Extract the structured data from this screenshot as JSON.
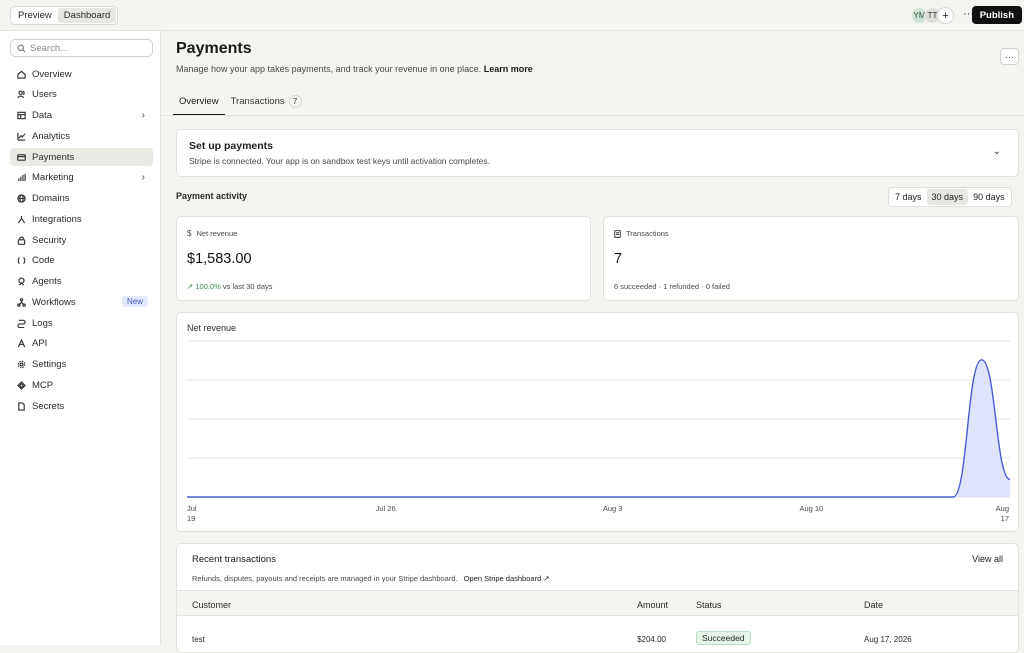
{
  "topbar": {
    "modes": [
      "Preview",
      "Dashboard"
    ],
    "active_mode": "Dashboard",
    "avatars": [
      "YM",
      "TT"
    ],
    "add_label": "+",
    "more_label": "···",
    "publish_label": "Publish"
  },
  "sidebar": {
    "search_placeholder": "Search...",
    "items": [
      {
        "label": "Overview",
        "icon": "home-icon"
      },
      {
        "label": "Users",
        "icon": "users-icon"
      },
      {
        "label": "Data",
        "icon": "table-icon",
        "chevron": "›"
      },
      {
        "label": "Analytics",
        "icon": "chart-line-icon"
      },
      {
        "label": "Payments",
        "icon": "credit-card-icon",
        "active": true
      },
      {
        "label": "Marketing",
        "icon": "bar-chart-icon",
        "chevron": "›"
      },
      {
        "label": "Domains",
        "icon": "globe-icon"
      },
      {
        "label": "Integrations",
        "icon": "integrations-icon"
      },
      {
        "label": "Security",
        "icon": "lock-icon"
      },
      {
        "label": "Code",
        "icon": "code-icon"
      },
      {
        "label": "Agents",
        "icon": "agent-icon"
      },
      {
        "label": "Workflows",
        "icon": "workflow-icon",
        "badge": "New"
      },
      {
        "label": "Logs",
        "icon": "logs-icon"
      },
      {
        "label": "API",
        "icon": "api-icon"
      },
      {
        "label": "Settings",
        "icon": "gear-icon"
      },
      {
        "label": "MCP",
        "icon": "mcp-icon"
      },
      {
        "label": "Secrets",
        "icon": "file-icon"
      }
    ]
  },
  "page": {
    "title": "Payments",
    "subtitle": "Manage how your app takes payments, and track your revenue in one place.",
    "learn_more": "Learn more",
    "more_label": "···",
    "tabs": [
      {
        "label": "Overview",
        "active": true
      },
      {
        "label": "Transactions",
        "count": "7"
      }
    ]
  },
  "setup": {
    "title": "Set up payments",
    "description": "Stripe is connected. Your app is on sandbox test keys until activation completes.",
    "chevron": "⌄"
  },
  "activity": {
    "label": "Payment activity",
    "ranges": [
      "7 days",
      "30 days",
      "90 days"
    ],
    "active_range": "30 days"
  },
  "stats": {
    "net_revenue": {
      "label": "Net revenue",
      "value": "$1,583.00",
      "change": "100.0%",
      "change_suffix": "vs last 30 days",
      "icon": "dollar-icon"
    },
    "transactions": {
      "label": "Transactions",
      "value": "7",
      "breakdown": "6 succeeded · 1 refunded · 0 failed",
      "icon": "receipt-icon"
    }
  },
  "chart_data": {
    "type": "area",
    "title": "Net revenue",
    "x_tick_labels": [
      [
        "Jul",
        "19"
      ],
      [
        "Jul 26"
      ],
      [
        "Aug 3"
      ],
      [
        "Aug 10"
      ],
      [
        "Aug",
        "17"
      ]
    ],
    "x": [
      "Jul 19",
      "Jul 20",
      "Jul 21",
      "Jul 22",
      "Jul 23",
      "Jul 24",
      "Jul 25",
      "Jul 26",
      "Jul 27",
      "Jul 28",
      "Jul 29",
      "Jul 30",
      "Jul 31",
      "Aug 1",
      "Aug 2",
      "Aug 3",
      "Aug 4",
      "Aug 5",
      "Aug 6",
      "Aug 7",
      "Aug 8",
      "Aug 9",
      "Aug 10",
      "Aug 11",
      "Aug 12",
      "Aug 13",
      "Aug 14",
      "Aug 15",
      "Aug 16",
      "Aug 17"
    ],
    "values": [
      0,
      0,
      0,
      0,
      0,
      0,
      0,
      0,
      0,
      0,
      0,
      0,
      0,
      0,
      0,
      0,
      0,
      0,
      0,
      0,
      0,
      0,
      0,
      0,
      0,
      0,
      0,
      0,
      1583,
      204
    ],
    "ylim": [
      0,
      1800
    ],
    "grid": true,
    "color": "#4a5bd4",
    "fill": "#dfe3fb"
  },
  "recent": {
    "title": "Recent transactions",
    "view_all": "View all",
    "description": "Refunds, disputes, payouts and receipts are managed in your Stripe dashboard.",
    "stripe_link": "Open Stripe dashboard ↗",
    "columns": [
      "Customer",
      "Amount",
      "Status",
      "Date"
    ],
    "rows": [
      {
        "customer": "test",
        "amount": "$204.00",
        "status": "Succeeded",
        "date": "Aug 17, 2026"
      }
    ]
  }
}
